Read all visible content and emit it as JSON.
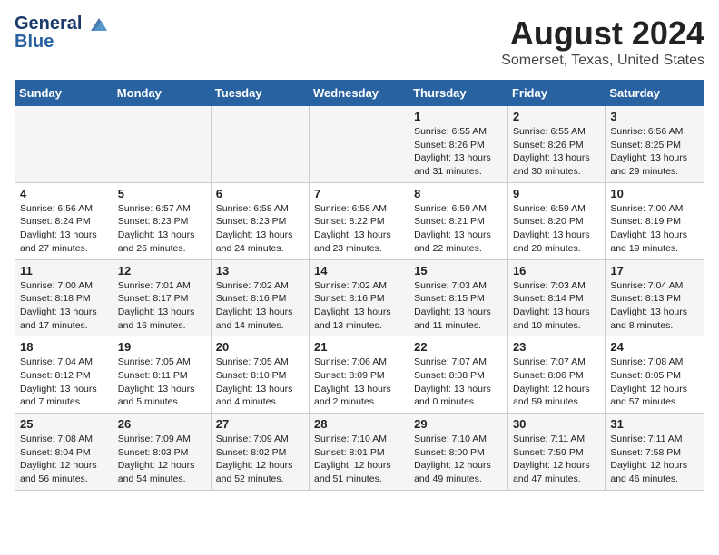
{
  "header": {
    "logo_line1": "General",
    "logo_line2": "Blue",
    "month_title": "August 2024",
    "location": "Somerset, Texas, United States"
  },
  "days_of_week": [
    "Sunday",
    "Monday",
    "Tuesday",
    "Wednesday",
    "Thursday",
    "Friday",
    "Saturday"
  ],
  "weeks": [
    [
      {
        "day": "",
        "content": ""
      },
      {
        "day": "",
        "content": ""
      },
      {
        "day": "",
        "content": ""
      },
      {
        "day": "",
        "content": ""
      },
      {
        "day": "1",
        "content": "Sunrise: 6:55 AM\nSunset: 8:26 PM\nDaylight: 13 hours\nand 31 minutes."
      },
      {
        "day": "2",
        "content": "Sunrise: 6:55 AM\nSunset: 8:26 PM\nDaylight: 13 hours\nand 30 minutes."
      },
      {
        "day": "3",
        "content": "Sunrise: 6:56 AM\nSunset: 8:25 PM\nDaylight: 13 hours\nand 29 minutes."
      }
    ],
    [
      {
        "day": "4",
        "content": "Sunrise: 6:56 AM\nSunset: 8:24 PM\nDaylight: 13 hours\nand 27 minutes."
      },
      {
        "day": "5",
        "content": "Sunrise: 6:57 AM\nSunset: 8:23 PM\nDaylight: 13 hours\nand 26 minutes."
      },
      {
        "day": "6",
        "content": "Sunrise: 6:58 AM\nSunset: 8:23 PM\nDaylight: 13 hours\nand 24 minutes."
      },
      {
        "day": "7",
        "content": "Sunrise: 6:58 AM\nSunset: 8:22 PM\nDaylight: 13 hours\nand 23 minutes."
      },
      {
        "day": "8",
        "content": "Sunrise: 6:59 AM\nSunset: 8:21 PM\nDaylight: 13 hours\nand 22 minutes."
      },
      {
        "day": "9",
        "content": "Sunrise: 6:59 AM\nSunset: 8:20 PM\nDaylight: 13 hours\nand 20 minutes."
      },
      {
        "day": "10",
        "content": "Sunrise: 7:00 AM\nSunset: 8:19 PM\nDaylight: 13 hours\nand 19 minutes."
      }
    ],
    [
      {
        "day": "11",
        "content": "Sunrise: 7:00 AM\nSunset: 8:18 PM\nDaylight: 13 hours\nand 17 minutes."
      },
      {
        "day": "12",
        "content": "Sunrise: 7:01 AM\nSunset: 8:17 PM\nDaylight: 13 hours\nand 16 minutes."
      },
      {
        "day": "13",
        "content": "Sunrise: 7:02 AM\nSunset: 8:16 PM\nDaylight: 13 hours\nand 14 minutes."
      },
      {
        "day": "14",
        "content": "Sunrise: 7:02 AM\nSunset: 8:16 PM\nDaylight: 13 hours\nand 13 minutes."
      },
      {
        "day": "15",
        "content": "Sunrise: 7:03 AM\nSunset: 8:15 PM\nDaylight: 13 hours\nand 11 minutes."
      },
      {
        "day": "16",
        "content": "Sunrise: 7:03 AM\nSunset: 8:14 PM\nDaylight: 13 hours\nand 10 minutes."
      },
      {
        "day": "17",
        "content": "Sunrise: 7:04 AM\nSunset: 8:13 PM\nDaylight: 13 hours\nand 8 minutes."
      }
    ],
    [
      {
        "day": "18",
        "content": "Sunrise: 7:04 AM\nSunset: 8:12 PM\nDaylight: 13 hours\nand 7 minutes."
      },
      {
        "day": "19",
        "content": "Sunrise: 7:05 AM\nSunset: 8:11 PM\nDaylight: 13 hours\nand 5 minutes."
      },
      {
        "day": "20",
        "content": "Sunrise: 7:05 AM\nSunset: 8:10 PM\nDaylight: 13 hours\nand 4 minutes."
      },
      {
        "day": "21",
        "content": "Sunrise: 7:06 AM\nSunset: 8:09 PM\nDaylight: 13 hours\nand 2 minutes."
      },
      {
        "day": "22",
        "content": "Sunrise: 7:07 AM\nSunset: 8:08 PM\nDaylight: 13 hours\nand 0 minutes."
      },
      {
        "day": "23",
        "content": "Sunrise: 7:07 AM\nSunset: 8:06 PM\nDaylight: 12 hours\nand 59 minutes."
      },
      {
        "day": "24",
        "content": "Sunrise: 7:08 AM\nSunset: 8:05 PM\nDaylight: 12 hours\nand 57 minutes."
      }
    ],
    [
      {
        "day": "25",
        "content": "Sunrise: 7:08 AM\nSunset: 8:04 PM\nDaylight: 12 hours\nand 56 minutes."
      },
      {
        "day": "26",
        "content": "Sunrise: 7:09 AM\nSunset: 8:03 PM\nDaylight: 12 hours\nand 54 minutes."
      },
      {
        "day": "27",
        "content": "Sunrise: 7:09 AM\nSunset: 8:02 PM\nDaylight: 12 hours\nand 52 minutes."
      },
      {
        "day": "28",
        "content": "Sunrise: 7:10 AM\nSunset: 8:01 PM\nDaylight: 12 hours\nand 51 minutes."
      },
      {
        "day": "29",
        "content": "Sunrise: 7:10 AM\nSunset: 8:00 PM\nDaylight: 12 hours\nand 49 minutes."
      },
      {
        "day": "30",
        "content": "Sunrise: 7:11 AM\nSunset: 7:59 PM\nDaylight: 12 hours\nand 47 minutes."
      },
      {
        "day": "31",
        "content": "Sunrise: 7:11 AM\nSunset: 7:58 PM\nDaylight: 12 hours\nand 46 minutes."
      }
    ]
  ]
}
